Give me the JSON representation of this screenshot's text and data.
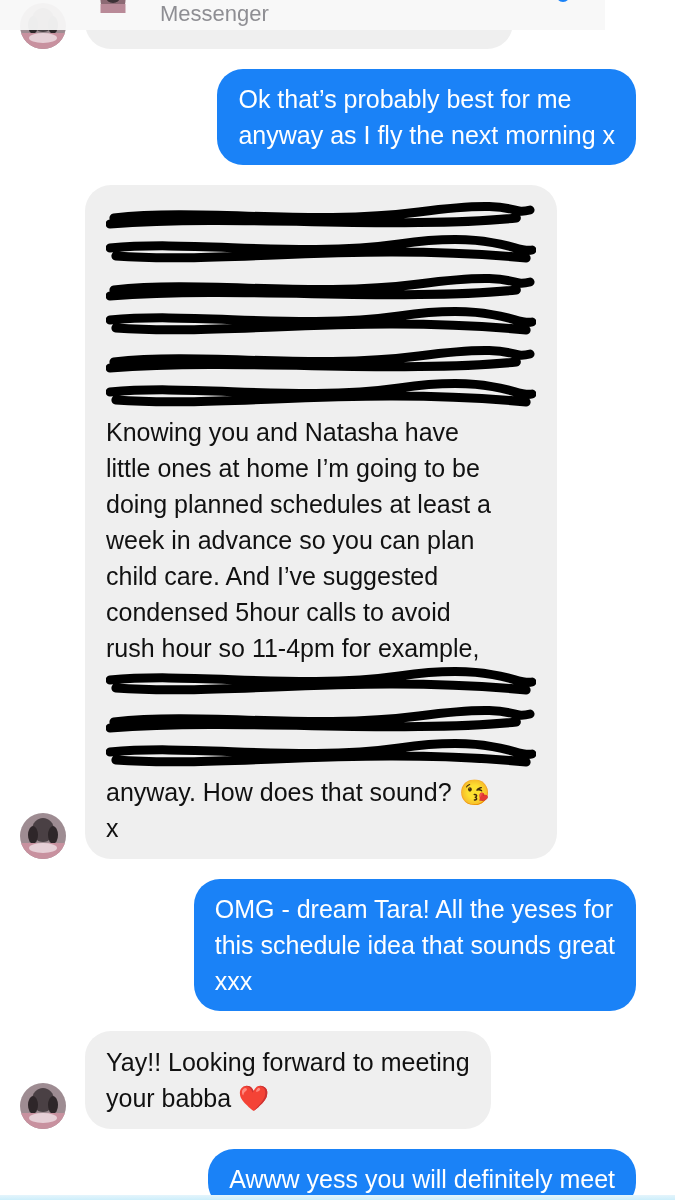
{
  "header": {
    "title": "Messenger"
  },
  "messages": [
    {
      "kind": "received",
      "avatar": true
    },
    {
      "kind": "sent",
      "avatar": false,
      "lines": [
        {
          "text": "Ok that’s probably best for me",
          "redacted": false
        },
        {
          "text": "anyway as I fly the next morning x",
          "redacted": false
        }
      ]
    },
    {
      "kind": "received",
      "avatar": true,
      "lines": [
        {
          "redacted": true
        },
        {
          "redacted": true
        },
        {
          "redacted": true
        },
        {
          "redacted": true
        },
        {
          "redacted": true
        },
        {
          "redacted": true
        },
        {
          "text": "Knowing you and Natasha have",
          "redacted": false
        },
        {
          "text": "little ones at home I’m going to be",
          "redacted": false
        },
        {
          "text": "doing planned schedules at least a",
          "redacted": false
        },
        {
          "text": "week in advance so you can plan",
          "redacted": false
        },
        {
          "text": "child care. And I’ve suggested",
          "redacted": false
        },
        {
          "text": "condensed 5hour calls to avoid",
          "redacted": false
        },
        {
          "text": "rush hour so 11-4pm for example,",
          "redacted": false
        },
        {
          "redacted": true
        },
        {
          "redacted": true
        },
        {
          "redacted": true
        },
        {
          "text": "anyway. How does that sound? 😘",
          "redacted": false
        },
        {
          "text": "x",
          "redacted": false
        }
      ]
    },
    {
      "kind": "sent",
      "avatar": false,
      "lines": [
        {
          "text": "OMG - dream Tara!  All the yeses for",
          "redacted": false
        },
        {
          "text": "this schedule idea that sounds great",
          "redacted": false
        },
        {
          "text": "xxx",
          "redacted": false
        }
      ]
    },
    {
      "kind": "received",
      "avatar": true,
      "lines": [
        {
          "text": "Yay!! Looking forward to meeting",
          "redacted": false
        },
        {
          "text": "your babba ❤️",
          "redacted": false
        }
      ]
    },
    {
      "kind": "sent",
      "avatar": false,
      "lines": [
        {
          "text": "Awww yess you will definitely meet",
          "redacted": false
        }
      ]
    }
  ]
}
